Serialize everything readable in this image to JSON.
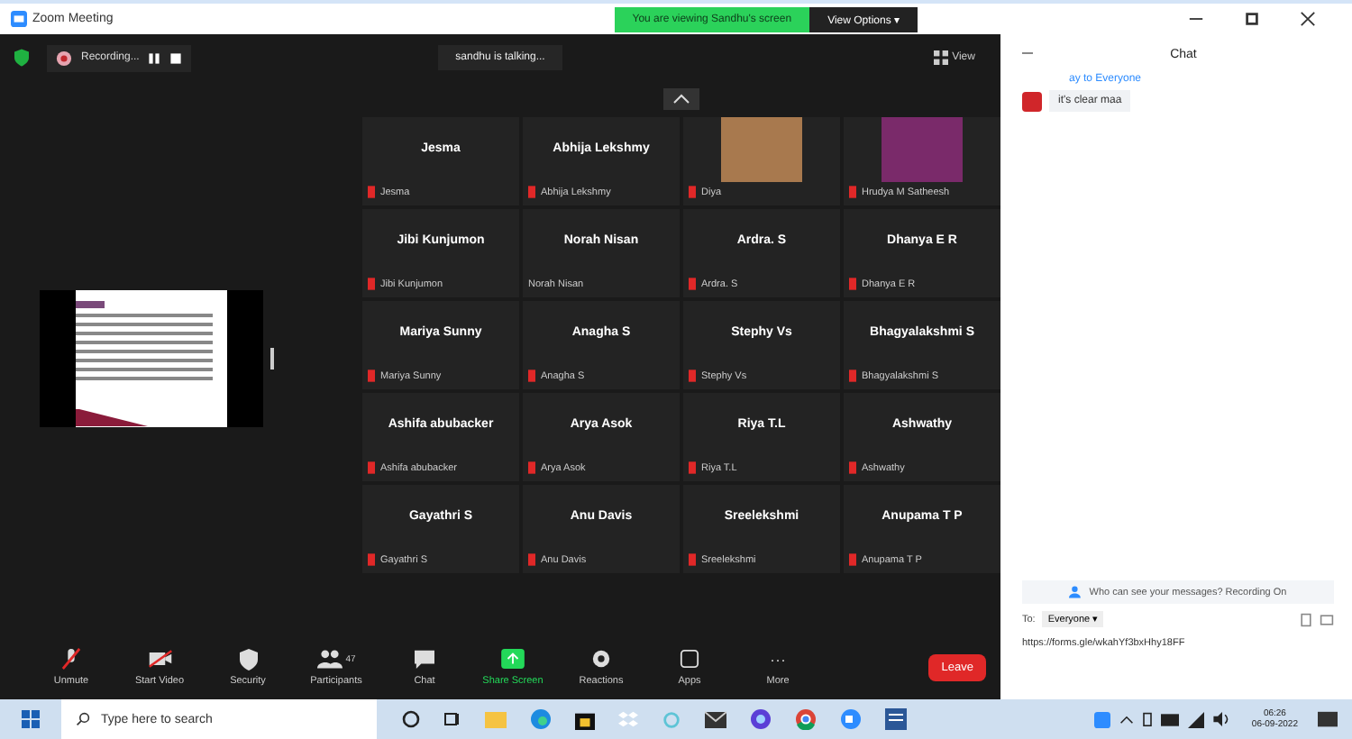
{
  "window": {
    "title": "Zoom Meeting"
  },
  "share_banner": {
    "text": "You are viewing Sandhu's screen",
    "button": "View Options ▾"
  },
  "top_bar": {
    "recording": "Recording...",
    "talking": "sandhu is talking...",
    "view": "View"
  },
  "tiles": [
    {
      "kind": "name",
      "name": "Jesma",
      "label": "Jesma",
      "muted": true
    },
    {
      "kind": "name",
      "name": "Abhija Lekshmy",
      "label": "Abhija Lekshmy",
      "muted": true
    },
    {
      "kind": "photo",
      "label": "Diya",
      "muted": true
    },
    {
      "kind": "photo",
      "label": "Hrudya M Satheesh",
      "muted": true
    },
    {
      "kind": "name",
      "name": "Jibi Kunjumon",
      "label": "Jibi Kunjumon",
      "muted": true
    },
    {
      "kind": "name",
      "name": "Norah Nisan",
      "label": "Norah Nisan",
      "muted": false
    },
    {
      "kind": "name",
      "name": "Ardra. S",
      "label": "Ardra. S",
      "muted": true
    },
    {
      "kind": "name",
      "name": "Dhanya E R",
      "label": "Dhanya E R",
      "muted": true
    },
    {
      "kind": "name",
      "name": "Mariya Sunny",
      "label": "Mariya Sunny",
      "muted": true
    },
    {
      "kind": "name",
      "name": "Anagha S",
      "label": "Anagha S",
      "muted": true
    },
    {
      "kind": "name",
      "name": "Stephy Vs",
      "label": "Stephy Vs",
      "muted": true
    },
    {
      "kind": "name",
      "name": "Bhagyalakshmi S",
      "label": "Bhagyalakshmi S",
      "muted": true
    },
    {
      "kind": "name",
      "name": "Ashifa abubacker",
      "label": "Ashifa abubacker",
      "muted": true
    },
    {
      "kind": "name",
      "name": "Arya Asok",
      "label": "Arya Asok",
      "muted": true
    },
    {
      "kind": "name",
      "name": "Riya T.L",
      "label": "Riya T.L",
      "muted": true
    },
    {
      "kind": "name",
      "name": "Ashwathy",
      "label": "Ashwathy",
      "muted": true
    },
    {
      "kind": "name",
      "name": "Gayathri S",
      "label": "Gayathri S",
      "muted": true
    },
    {
      "kind": "name",
      "name": "Anu Davis",
      "label": "Anu Davis",
      "muted": true
    },
    {
      "kind": "name",
      "name": "Sreelekshmi",
      "label": "Sreelekshmi",
      "muted": true
    },
    {
      "kind": "name",
      "name": "Anupama T P",
      "label": "Anupama T P",
      "muted": true
    }
  ],
  "toolbar": [
    {
      "kind": "unmute",
      "label": "Unmute"
    },
    {
      "kind": "video",
      "label": "Start Video"
    },
    {
      "kind": "security",
      "label": "Security"
    },
    {
      "kind": "participants",
      "label": "Participants",
      "count": "47"
    },
    {
      "kind": "chat",
      "label": "Chat"
    },
    {
      "kind": "share",
      "label": "Share Screen"
    },
    {
      "kind": "reactions",
      "label": "Reactions"
    },
    {
      "kind": "apps",
      "label": "Apps"
    },
    {
      "kind": "more",
      "label": "More",
      "glyph": "···"
    }
  ],
  "leave": "Leave",
  "chat": {
    "title": "Chat",
    "sender": "ay to Everyone",
    "message": "it's clear maa",
    "notice": "Who can see your messages? Recording On",
    "to": "To:",
    "recipient": "Everyone ▾",
    "draft": "https://forms.gle/wkahYf3bxHhy18FF"
  },
  "taskbar": {
    "search": "Type here to search",
    "time": "06:26",
    "date": "06-09-2022"
  }
}
